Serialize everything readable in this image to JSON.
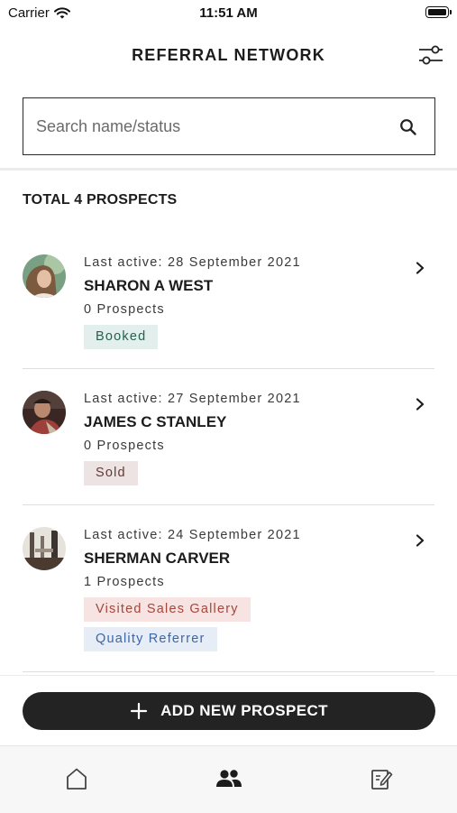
{
  "status_bar": {
    "carrier": "Carrier",
    "time": "11:51 AM"
  },
  "header": {
    "title": "REFERRAL NETWORK",
    "filter_icon": "sliders-icon"
  },
  "search": {
    "placeholder": "Search name/status",
    "value": "",
    "icon": "search-icon"
  },
  "summary": {
    "total_label": "TOTAL 4 PROSPECTS"
  },
  "prospects": [
    {
      "last_active": "Last active: 28 September 2021",
      "name": "SHARON A WEST",
      "prospects_count": "0 Prospects",
      "tags": [
        {
          "label": "Booked",
          "kind": "booked"
        }
      ]
    },
    {
      "last_active": "Last active: 27 September 2021",
      "name": "JAMES C STANLEY",
      "prospects_count": "0 Prospects",
      "tags": [
        {
          "label": "Sold",
          "kind": "sold"
        }
      ]
    },
    {
      "last_active": "Last active: 24 September 2021",
      "name": "SHERMAN CARVER",
      "prospects_count": "1 Prospects",
      "tags": [
        {
          "label": "Visited Sales Gallery",
          "kind": "visited"
        },
        {
          "label": "Quality Referrer",
          "kind": "quality"
        }
      ]
    }
  ],
  "cta": {
    "label": "ADD NEW PROSPECT",
    "icon": "plus-icon"
  },
  "tab_bar": {
    "tabs": [
      {
        "icon": "home-icon",
        "active": false
      },
      {
        "icon": "people-icon",
        "active": true
      },
      {
        "icon": "edit-note-icon",
        "active": false
      }
    ]
  },
  "colors": {
    "primary_dark": "#232323",
    "tag_booked_bg": "#e3efec",
    "tag_booked_text": "#24614f",
    "tag_sold_bg": "#ece3e2",
    "tag_sold_text": "#5e3b37",
    "tag_visited_bg": "#f7e3e1",
    "tag_visited_text": "#a5463c",
    "tag_quality_bg": "#e6edf7",
    "tag_quality_text": "#3e66a5"
  }
}
